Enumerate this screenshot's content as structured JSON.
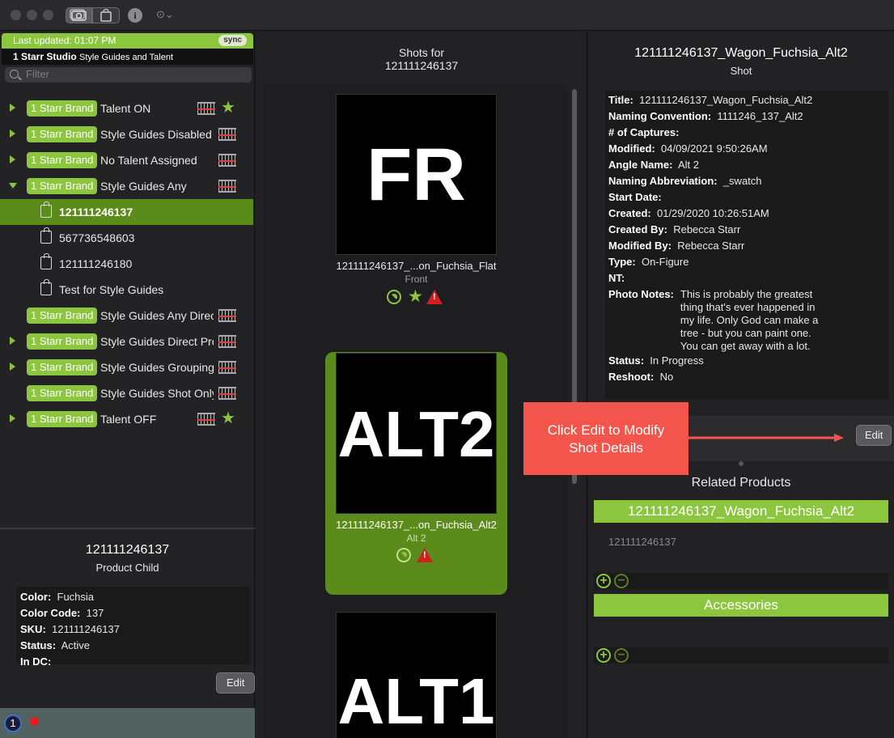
{
  "titlebar": {},
  "left": {
    "updated": "Last updated: 01:07 PM",
    "sync": "sync",
    "studio_name": "1 Starr Studio",
    "studio_sub": "Style Guides and Talent",
    "filter_placeholder": "Filter",
    "tree": [
      {
        "tag": "1 Starr Brand",
        "label": "Talent ON"
      },
      {
        "tag": "1 Starr Brand",
        "label": "Style Guides Disabled"
      },
      {
        "tag": "1 Starr Brand",
        "label": "No Talent Assigned"
      },
      {
        "tag": "1 Starr Brand",
        "label": "Style Guides Any"
      },
      {
        "label": "121111246137"
      },
      {
        "label": "567736548603"
      },
      {
        "label": "121111246180"
      },
      {
        "label": "Test for Style Guides"
      },
      {
        "tag": "1 Starr Brand",
        "label": "Style Guides Any Direc"
      },
      {
        "tag": "1 Starr Brand",
        "label": "Style Guides Direct Pro"
      },
      {
        "tag": "1 Starr Brand",
        "label": "Style Guides Grouping"
      },
      {
        "tag": "1 Starr Brand",
        "label": "Style Guides Shot Only"
      },
      {
        "tag": "1 Starr Brand",
        "label": "Talent OFF"
      }
    ],
    "product": {
      "id": "121111246137",
      "type": "Product Child",
      "fields": [
        {
          "k": "Color:",
          "v": "Fuchsia"
        },
        {
          "k": "Color Code:",
          "v": "137"
        },
        {
          "k": "SKU:",
          "v": "121111246137"
        },
        {
          "k": "Status:",
          "v": "Active"
        },
        {
          "k": "In DC:",
          "v": ""
        }
      ],
      "edit": "Edit"
    },
    "status_icon": "1"
  },
  "middle": {
    "title_line1": "Shots for",
    "title_line2": "121111246137",
    "shots": [
      {
        "thumb": "FR",
        "name": "121111246137_...on_Fuchsia_Flat",
        "angle": "Front"
      },
      {
        "thumb": "ALT2",
        "name": "121111246137_...on_Fuchsia_Alt2",
        "angle": "Alt 2"
      },
      {
        "thumb": "ALT1"
      }
    ]
  },
  "right": {
    "title": "121111246137_Wagon_Fuchsia_Alt2",
    "subtitle": "Shot",
    "fields": [
      {
        "k": "Title:",
        "v": "121111246137_Wagon_Fuchsia_Alt2"
      },
      {
        "k": "Naming Convention:",
        "v": "1111246_137_Alt2"
      },
      {
        "k": "# of Captures:",
        "v": ""
      },
      {
        "k": "Modified:",
        "v": "04/09/2021 9:50:26AM"
      },
      {
        "k": "Angle Name:",
        "v": "Alt 2"
      },
      {
        "k": "Naming Abbreviation:",
        "v": "_swatch"
      },
      {
        "k": "Start Date:",
        "v": ""
      },
      {
        "k": "Created:",
        "v": "01/29/2020 10:26:51AM"
      },
      {
        "k": "Created By:",
        "v": "Rebecca Starr"
      },
      {
        "k": "Modified By:",
        "v": "Rebecca Starr"
      },
      {
        "k": "Type:",
        "v": "On-Figure"
      },
      {
        "k": "NT:",
        "v": ""
      }
    ],
    "notes_label": "Photo Notes:",
    "notes": "This is probably the greatest thing that's ever happened in my life. Only God can make a tree - but you can paint one. You can get away with a lot.",
    "fields2": [
      {
        "k": "Status:",
        "v": "In Progress"
      },
      {
        "k": "Reshoot:",
        "v": "No"
      }
    ],
    "edit": "Edit",
    "related_title": "Related Products",
    "related_bar": "121111246137_Wagon_Fuchsia_Alt2",
    "related_item": "121111246137",
    "accessories": "Accessories"
  },
  "callout": {
    "line1": "Click Edit to Modify",
    "line2": "Shot Details"
  },
  "colors": {
    "accent": "#8cc63f",
    "selected": "#5b8c1b",
    "callout": "#f3554c"
  }
}
